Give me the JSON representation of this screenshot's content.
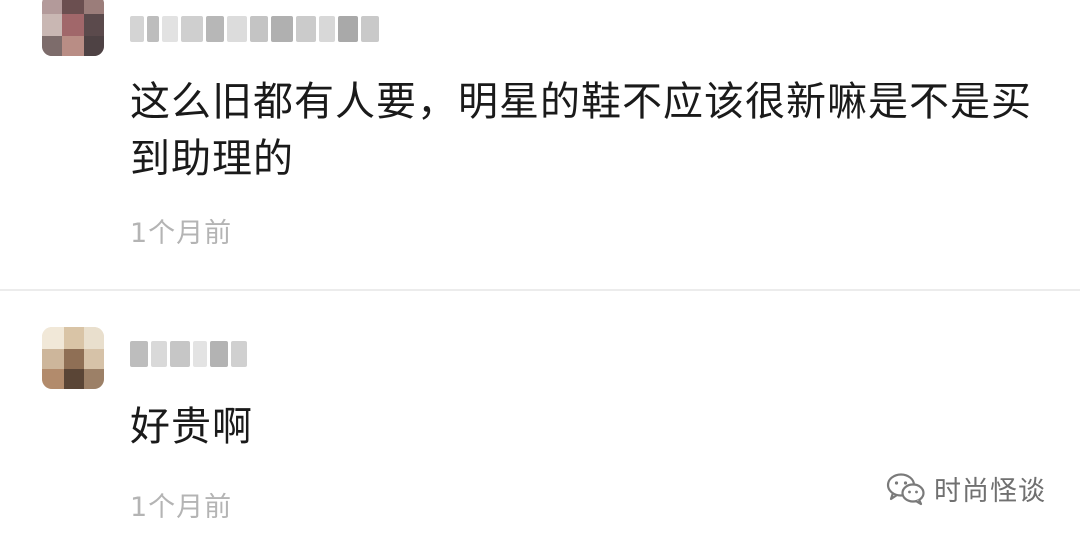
{
  "comments": [
    {
      "text": "这么旧都有人要，明星的鞋不应该很新嘛是不是买到助理的",
      "time": "1个月前"
    },
    {
      "text": "好贵啊",
      "time": "1个月前"
    }
  ],
  "watermark": {
    "text": "时尚怪谈",
    "icon": "wechat-icon"
  },
  "colors": {
    "text": "#1a1a1a",
    "timestamp": "#b4b4b4",
    "divider": "#ececec",
    "watermark": "#707070"
  }
}
